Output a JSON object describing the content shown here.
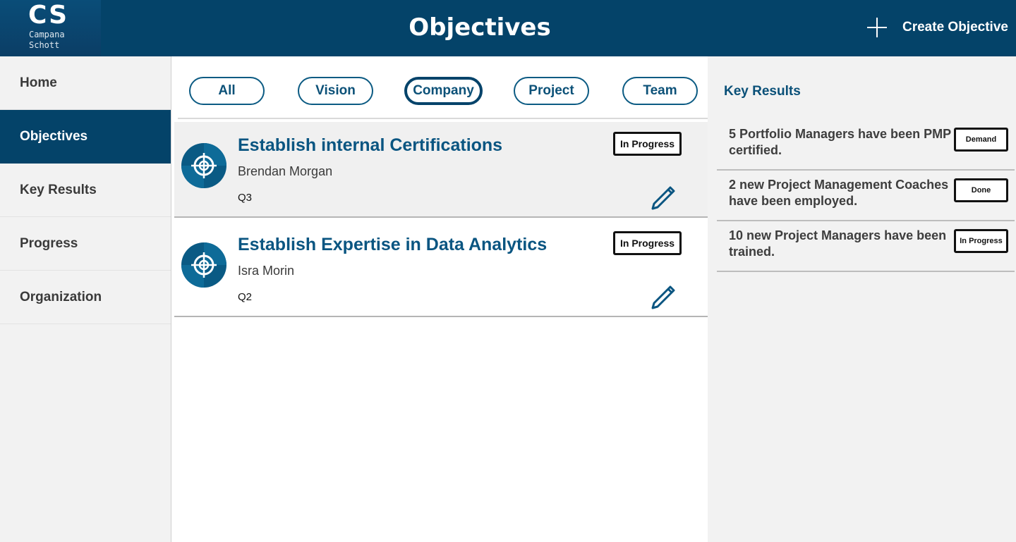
{
  "header": {
    "logo_mark": "CS",
    "logo_line1": "Campana",
    "logo_line2": "Schott",
    "title": "Objectives",
    "create_label": "Create Objective",
    "color": "#044369"
  },
  "sidebar": {
    "items": [
      {
        "label": "Home",
        "active": false
      },
      {
        "label": "Objectives",
        "active": true
      },
      {
        "label": "Key Results",
        "active": false
      },
      {
        "label": "Progress",
        "active": false
      },
      {
        "label": "Organization",
        "active": false
      }
    ]
  },
  "filters": {
    "items": [
      "All",
      "Vision",
      "Company",
      "Project",
      "Team"
    ],
    "selected": "Company"
  },
  "objectives": [
    {
      "title": "Establish internal Certifications",
      "owner": "Brendan Morgan",
      "quarter": "Q3",
      "status": "In Progress",
      "icon": "target-icon",
      "selected": true
    },
    {
      "title": "Establish Expertise in Data Analytics",
      "owner": "Isra Morin",
      "quarter": "Q2",
      "status": "In Progress",
      "icon": "target-icon",
      "selected": false
    }
  ],
  "key_results": {
    "heading": "Key Results",
    "items": [
      {
        "text": "5 Portfolio Managers have been PMP certified.",
        "status": "Demand"
      },
      {
        "text": "2 new Project Management Coaches have been employed.",
        "status": "Done"
      },
      {
        "text": "10 new Project Managers have been trained.",
        "status": "In Progress"
      }
    ]
  },
  "colors": {
    "accent": "#044369",
    "accent_light": "#0a5581",
    "panel_bg": "#f2f2f2"
  }
}
